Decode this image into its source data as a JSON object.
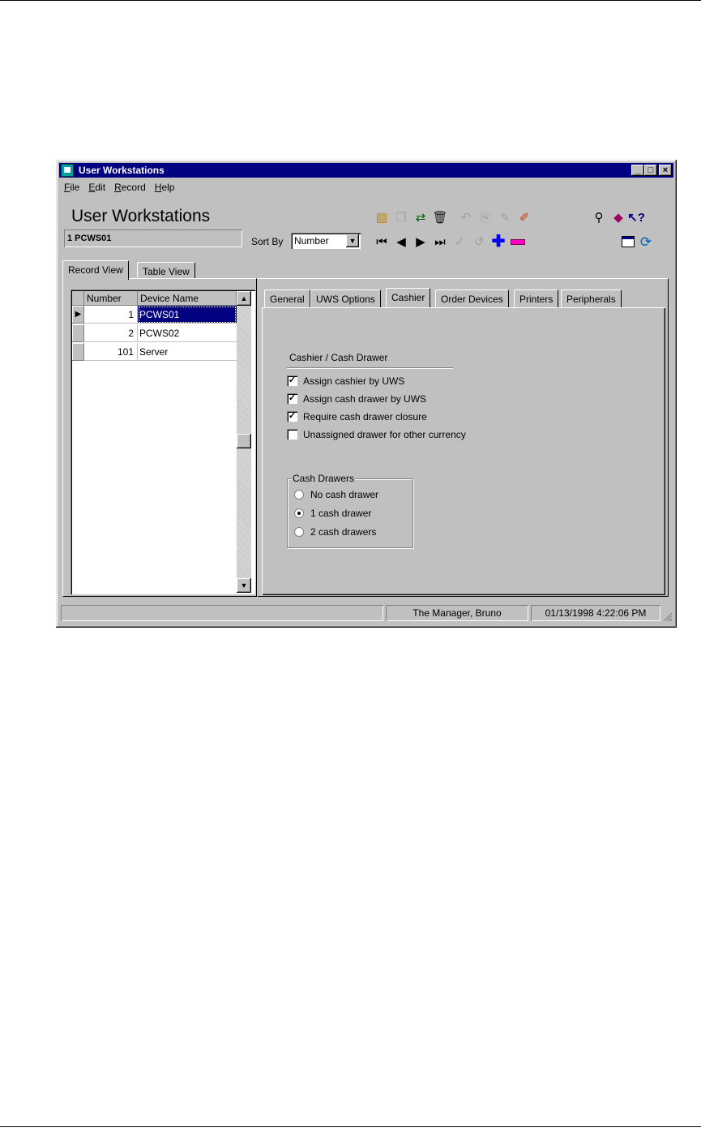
{
  "window": {
    "title": "User Workstations",
    "controls": {
      "minimize": "_",
      "maximize": "□",
      "close": "×"
    }
  },
  "menu": [
    "File",
    "Edit",
    "Record",
    "Help"
  ],
  "header": {
    "title": "User Workstations",
    "current_record": "1 PCWS01",
    "sort_by_label": "Sort By",
    "sort_by_value": "Number"
  },
  "toolbar_icons": [
    "new-record-icon",
    "copy-icon",
    "replace-icon",
    "delete-icon",
    "undo-icon",
    "paste-icon",
    "clear-icon",
    "edit-icon",
    "find-icon",
    "help-book-icon",
    "context-help-icon",
    "first-record-icon",
    "previous-record-icon",
    "next-record-icon",
    "last-record-icon",
    "accept-icon",
    "cancel-icon",
    "add-icon",
    "remove-icon",
    "view-icon",
    "refresh-icon"
  ],
  "view_tabs": [
    "Record View",
    "Table View"
  ],
  "grid": {
    "columns": [
      "Number",
      "Device Name"
    ],
    "rows": [
      {
        "number": "1",
        "device": "PCWS01",
        "selected": true
      },
      {
        "number": "2",
        "device": "PCWS02",
        "selected": false
      },
      {
        "number": "101",
        "device": "Server",
        "selected": false
      }
    ]
  },
  "detail_tabs": [
    "General",
    "UWS Options",
    "Cashier",
    "Order Devices",
    "Printers",
    "Peripherals"
  ],
  "active_detail_tab": "Cashier",
  "cashier": {
    "section_label": "Cashier / Cash Drawer",
    "options": [
      {
        "label": "Assign cashier by UWS",
        "checked": true
      },
      {
        "label": "Assign cash drawer by UWS",
        "checked": true
      },
      {
        "label": "Require cash drawer closure",
        "checked": true
      },
      {
        "label": "Unassigned drawer for other currency",
        "checked": false
      }
    ],
    "cash_drawers_label": "Cash Drawers",
    "cash_drawers": [
      {
        "label": "No cash drawer",
        "selected": false
      },
      {
        "label": "1 cash drawer",
        "selected": true
      },
      {
        "label": "2 cash drawers",
        "selected": false
      }
    ]
  },
  "status": {
    "user": "The Manager, Bruno",
    "datetime": "01/13/1998 4:22:06 PM"
  }
}
